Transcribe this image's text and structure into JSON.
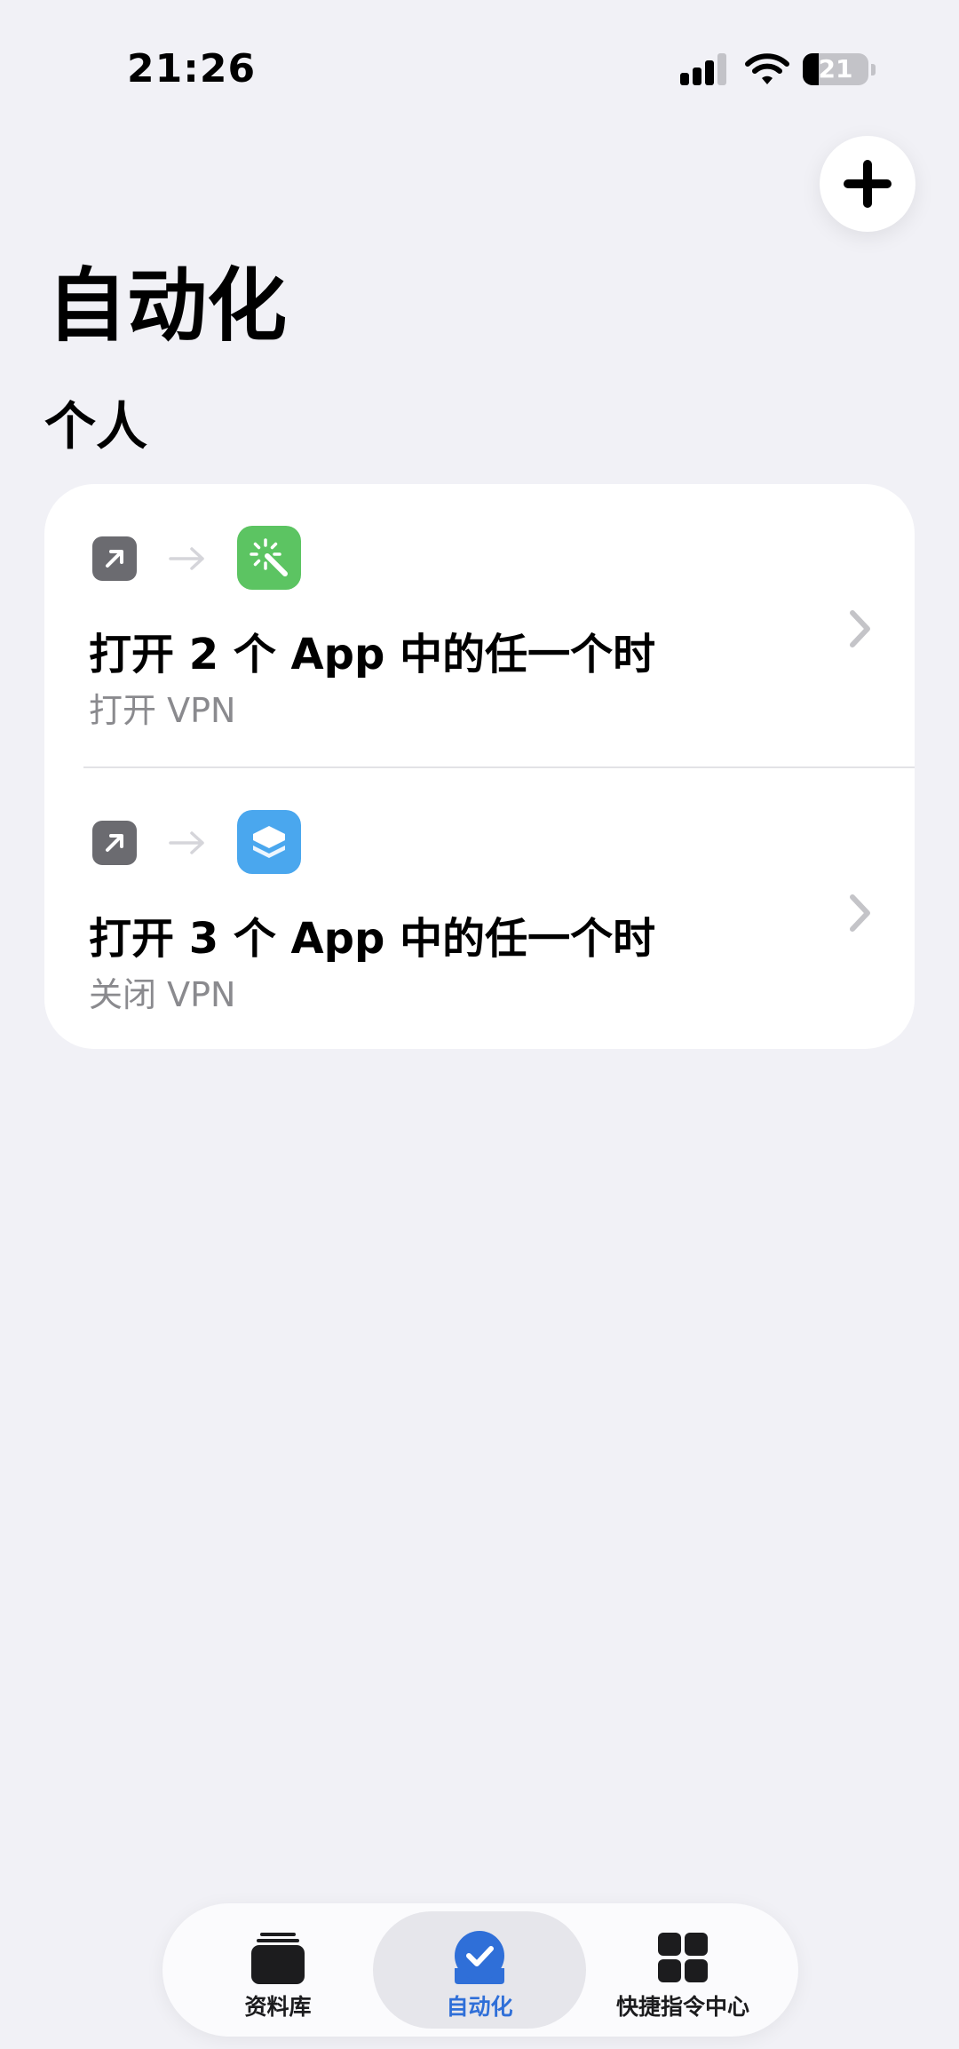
{
  "status": {
    "time": "21:26",
    "battery": "21"
  },
  "header": {
    "title": "自动化"
  },
  "section": {
    "title": "个人"
  },
  "automations": [
    {
      "title": "打开 2 个 App 中的任一个时",
      "subtitle": "打开 VPN",
      "app_icon": "magic-wand-icon"
    },
    {
      "title": "打开 3 个 App 中的任一个时",
      "subtitle": "关闭 VPN",
      "app_icon": "layers-icon"
    }
  ],
  "tabs": [
    {
      "label": "资料库",
      "icon": "library-icon"
    },
    {
      "label": "自动化",
      "icon": "automation-check-icon",
      "active": true
    },
    {
      "label": "快捷指令中心",
      "icon": "gallery-grid-icon"
    }
  ],
  "colors": {
    "accent": "#2f6fd8",
    "green_app": "#5cc462",
    "blue_app": "#4aa7ee",
    "background": "#f1f1f6"
  }
}
